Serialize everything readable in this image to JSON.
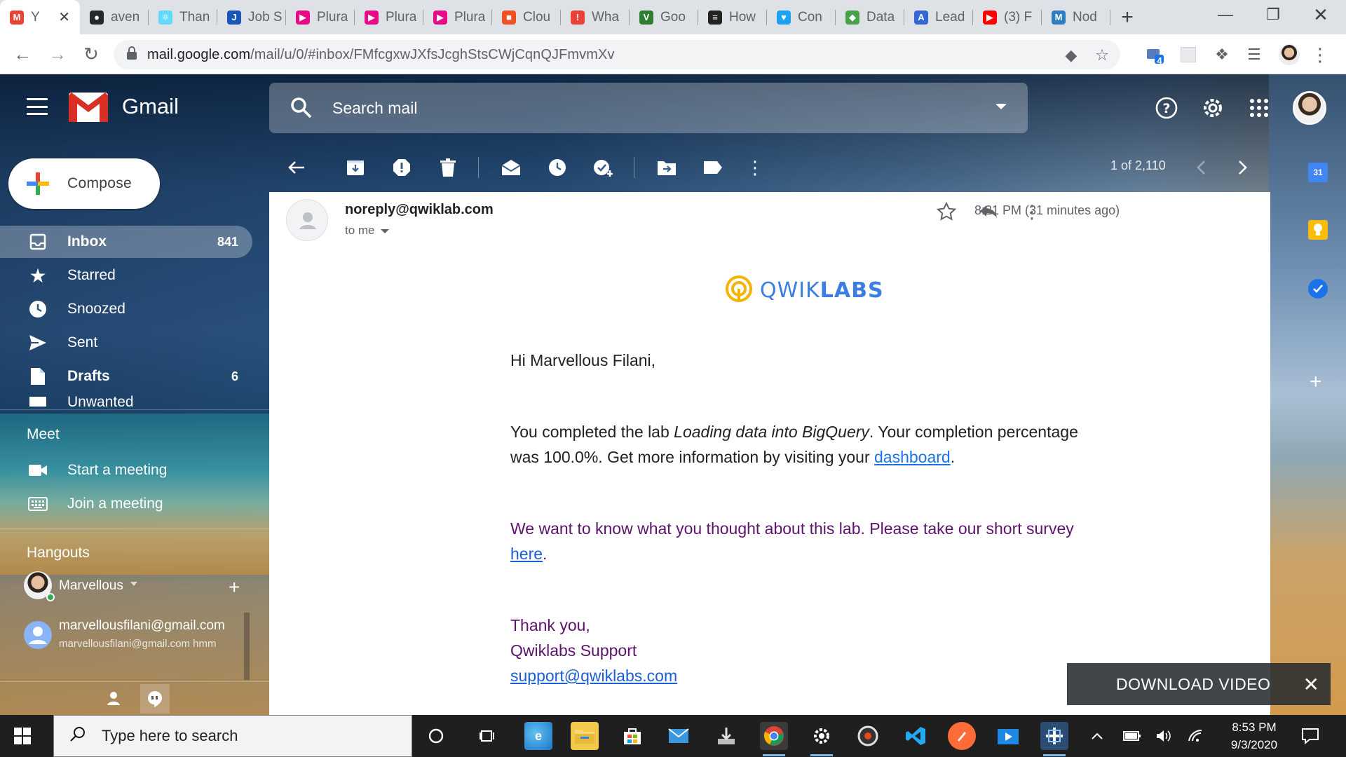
{
  "browser": {
    "tabs": [
      {
        "title": "Y",
        "favicon": "gmail-icon",
        "color": "#ea4335",
        "glyph": "M"
      },
      {
        "title": "aven",
        "favicon": "github-icon",
        "color": "#24292e",
        "glyph": "●"
      },
      {
        "title": "Than",
        "favicon": "react-icon",
        "color": "#61dafb",
        "glyph": "⚛"
      },
      {
        "title": "Job S",
        "favicon": "job-icon",
        "color": "#1a56b8",
        "glyph": "J"
      },
      {
        "title": "Plura",
        "favicon": "pluralsight-icon",
        "color": "#e80a89",
        "glyph": "▶"
      },
      {
        "title": "Plura",
        "favicon": "pluralsight-icon",
        "color": "#e80a89",
        "glyph": "▶"
      },
      {
        "title": "Plura",
        "favicon": "pluralsight-icon",
        "color": "#e80a89",
        "glyph": "▶"
      },
      {
        "title": "Clou",
        "favicon": "microsoft-icon",
        "color": "#f25022",
        "glyph": "■"
      },
      {
        "title": "Wha",
        "favicon": "alert-icon",
        "color": "#ea4335",
        "glyph": "!"
      },
      {
        "title": "Goo",
        "favicon": "tv-icon",
        "color": "#2e7d32",
        "glyph": "V"
      },
      {
        "title": "How",
        "favicon": "how-icon",
        "color": "#222222",
        "glyph": "≡"
      },
      {
        "title": "Con",
        "favicon": "twitter-icon",
        "color": "#1da1f2",
        "glyph": "♥"
      },
      {
        "title": "Data",
        "favicon": "mongodb-icon",
        "color": "#47a248",
        "glyph": "◆"
      },
      {
        "title": "Lead",
        "favicon": "angular-icon",
        "color": "#3367d6",
        "glyph": "A"
      },
      {
        "title": "(3) F",
        "favicon": "youtube-icon",
        "color": "#ff0000",
        "glyph": "▶"
      },
      {
        "title": "Nod",
        "favicon": "node-icon",
        "color": "#2e7dc1",
        "glyph": "M"
      }
    ],
    "url_host": "mail.google.com",
    "url_path": "/mail/u/0/#inbox/FMfcgxwJXfsJcghStsCWjCqnQJFmvmXv",
    "extension_badge": "4"
  },
  "gmail": {
    "app_name": "Gmail",
    "search_placeholder": "Search mail",
    "compose_label": "Compose",
    "nav": [
      {
        "label": "Inbox",
        "count": "841"
      },
      {
        "label": "Starred",
        "count": ""
      },
      {
        "label": "Snoozed",
        "count": ""
      },
      {
        "label": "Sent",
        "count": ""
      },
      {
        "label": "Drafts",
        "count": "6"
      },
      {
        "label": "Unwanted",
        "count": ""
      }
    ],
    "meet": {
      "heading": "Meet",
      "start": "Start a meeting",
      "join": "Join a meeting"
    },
    "hangouts": {
      "heading": "Hangouts",
      "user": "Marvellous",
      "contact_name": "marvellousfilani@gmail.com",
      "contact_status": "marvellousfilani@gmail.com  hmm"
    },
    "pager": "1 of 2,110",
    "message": {
      "sender": "noreply@qwiklab.com",
      "to": "to me",
      "time": "8:21 PM (31 minutes ago)",
      "logo_light": "QWIK",
      "logo_bold": "LABS",
      "greeting": "Hi Marvellous Filani,",
      "p1_a": "You completed the lab ",
      "p1_lab": "Loading data into BigQuery",
      "p1_b": ". Your completion percentage was 100.0%. Get more information by visiting your ",
      "p1_link": "dashboard",
      "p1_c": ".",
      "p2_a": "We want to know what you thought about this lab. Please take our short survey ",
      "p2_link": "here",
      "p2_b": ".",
      "thanks": "Thank you,",
      "signature": "Qwiklabs Support",
      "support_email": "support@qwiklabs.com"
    },
    "download_overlay": "DOWNLOAD VIDEO"
  },
  "taskbar": {
    "search_placeholder": "Type here to search",
    "time": "8:53 PM",
    "date": "9/3/2020"
  }
}
